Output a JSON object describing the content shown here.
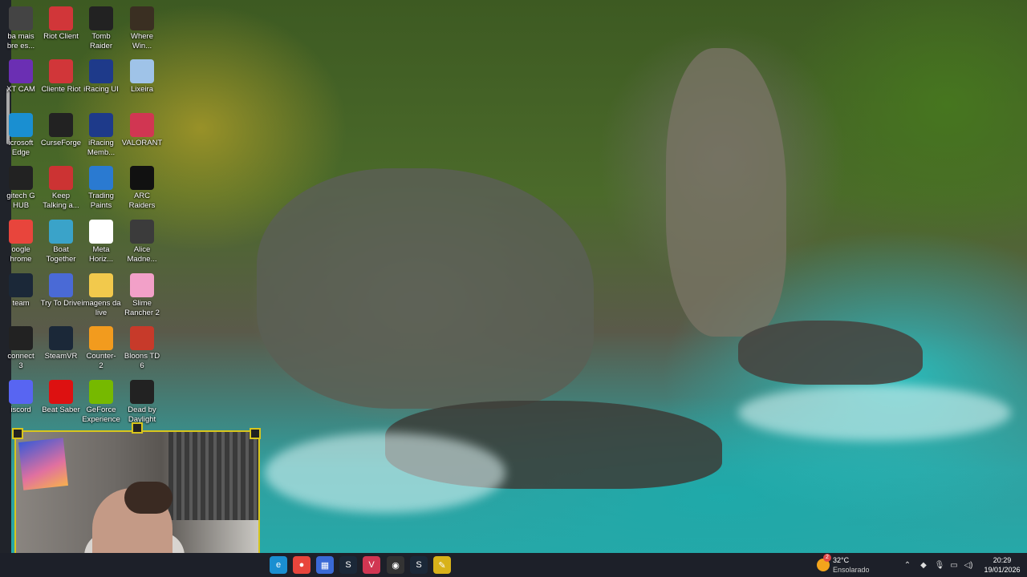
{
  "desktop": {
    "icons": [
      {
        "label": "ba mais\nbre es...",
        "icon": "gear-icon",
        "color": "#444"
      },
      {
        "label": "Riot Client",
        "icon": "riot-icon",
        "color": "#d13639"
      },
      {
        "label": "Tomb\nRaider",
        "icon": "tomb-raider-icon",
        "color": "#222"
      },
      {
        "label": "Where\nWin...",
        "icon": "game-icon",
        "color": "#3a2f22"
      },
      {
        "label": "XT CAM",
        "icon": "nzxt-icon",
        "color": "#6b2fb3"
      },
      {
        "label": "Cliente Riot",
        "icon": "riot-icon",
        "color": "#d13639"
      },
      {
        "label": "iRacing UI",
        "icon": "iracing-icon",
        "color": "#1e3a8a"
      },
      {
        "label": "Lixeira",
        "icon": "recycle-bin-icon",
        "color": "#9fc3e8"
      },
      {
        "label": "icrosoft\nEdge",
        "icon": "edge-icon",
        "color": "#1a8fd1"
      },
      {
        "label": "CurseForge",
        "icon": "curseforge-icon",
        "color": "#222"
      },
      {
        "label": "iRacing\nMemb...",
        "icon": "iracing-icon",
        "color": "#1e3a8a"
      },
      {
        "label": "VALORANT",
        "icon": "valorant-icon",
        "color": "#d13652"
      },
      {
        "label": "gitech G\nHUB",
        "icon": "ghub-icon",
        "color": "#222"
      },
      {
        "label": "Keep\nTalking a...",
        "icon": "bomb-icon",
        "color": "#c33"
      },
      {
        "label": "Trading\nPaints",
        "icon": "trading-paints-icon",
        "color": "#2a7ad1"
      },
      {
        "label": "ARC\nRaiders",
        "icon": "arc-raiders-icon",
        "color": "#111"
      },
      {
        "label": "oogle\nhrome",
        "icon": "chrome-icon",
        "color": "#e8453c"
      },
      {
        "label": "Boat\nTogether",
        "icon": "boat-icon",
        "color": "#3aa3c9"
      },
      {
        "label": "Meta\nHoriz...",
        "icon": "meta-icon",
        "color": "#fff"
      },
      {
        "label": "Alice\nMadne...",
        "icon": "game-icon",
        "color": "#3b3b3b"
      },
      {
        "label": "team",
        "icon": "steam-icon",
        "color": "#1b2838"
      },
      {
        "label": "Try To Drive",
        "icon": "car-icon",
        "color": "#4a6ad6"
      },
      {
        "label": "imagens da\nlive",
        "icon": "folder-icon",
        "color": "#f2c94c"
      },
      {
        "label": "Slime\nRancher 2",
        "icon": "slime-icon",
        "color": "#f2a0c8"
      },
      {
        "label": "connect\n3",
        "icon": "connect-icon",
        "color": "#222"
      },
      {
        "label": "SteamVR",
        "icon": "steamvr-icon",
        "color": "#1b2838"
      },
      {
        "label": "Counter-\n2",
        "icon": "counter-strike-icon",
        "color": "#f29b1e"
      },
      {
        "label": "Bloons TD\n6",
        "icon": "bloons-icon",
        "color": "#c73a2a"
      },
      {
        "label": "iscord",
        "icon": "discord-icon",
        "color": "#5865f2"
      },
      {
        "label": "Beat Saber",
        "icon": "beat-saber-icon",
        "color": "#d11"
      },
      {
        "label": "GeForce\nExperience",
        "icon": "geforce-icon",
        "color": "#76b900"
      },
      {
        "label": "Dead by\nDaylight",
        "icon": "dbd-icon",
        "color": "#222"
      }
    ]
  },
  "taskbar": {
    "apps": [
      {
        "name": "edge-icon",
        "color": "#1a8fd1",
        "glyph": "e"
      },
      {
        "name": "chrome-icon",
        "color": "#e8453c",
        "glyph": "●"
      },
      {
        "name": "store-icon",
        "color": "#3a6ad6",
        "glyph": "▦"
      },
      {
        "name": "steam-icon",
        "color": "#1b2838",
        "glyph": "S"
      },
      {
        "name": "valorant-icon",
        "color": "#d13652",
        "glyph": "V"
      },
      {
        "name": "obs-icon",
        "color": "#333",
        "glyph": "◉"
      },
      {
        "name": "steam-icon",
        "color": "#1b2838",
        "glyph": "S"
      },
      {
        "name": "tool-icon",
        "color": "#d8b21a",
        "glyph": "✎"
      }
    ],
    "weather": {
      "temp": "32°C",
      "desc": "Ensolarado",
      "badge": "2"
    },
    "time": "20:29",
    "date": "19/01/2026"
  }
}
